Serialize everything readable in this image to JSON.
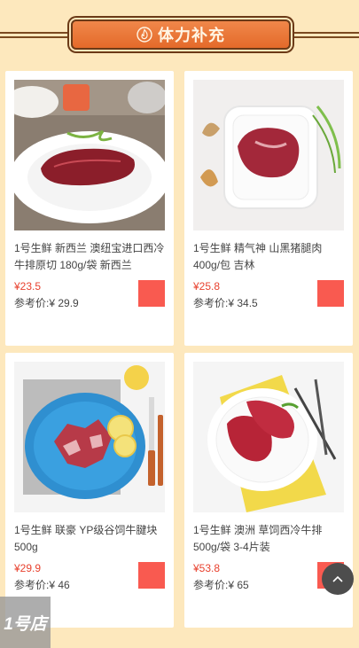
{
  "banner": {
    "title": "体力补充",
    "icon": "flame-icon"
  },
  "products": [
    {
      "name": "1号生鲜 新西兰 澳纽宝进口西冷牛排原切 180g/袋 新西兰",
      "price": "¥23.5",
      "ref": "参考价:¥ 29.9"
    },
    {
      "name": "1号生鲜 精气神 山黑猪腿肉 400g/包 吉林",
      "price": "¥25.8",
      "ref": "参考价:¥ 34.5"
    },
    {
      "name": "1号生鲜 联豪 YP级谷饲牛腱块 500g",
      "price": "¥29.9",
      "ref": "参考价:¥ 46"
    },
    {
      "name": "1号生鲜 澳洲 草饲西冷牛排 500g/袋 3-4片装",
      "price": "¥53.8",
      "ref": "参考价:¥ 65"
    }
  ],
  "colors": {
    "accent": "#f95a50",
    "price": "#e8412e",
    "background": "#fde8bd",
    "banner": "#e46a2a"
  },
  "floating": {
    "back_to_top_icon": "chevron-up-icon",
    "shop_label": "1号店"
  }
}
